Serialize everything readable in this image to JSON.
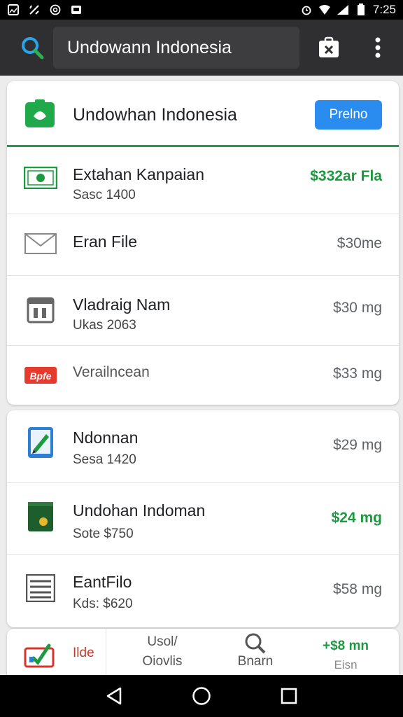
{
  "status_bar": {
    "time": "7:25"
  },
  "app_bar": {
    "search_text": "Undowann Indonesia"
  },
  "card1": {
    "header": {
      "title": "Undowhan Indonesia",
      "button_label": "Prelno"
    },
    "rows": [
      {
        "name": "Extahan Kanpaian",
        "sub": "Sasc 1400",
        "price": "$332ar Fla",
        "icon": "money-icon",
        "price_green": true
      },
      {
        "name": "Eran File",
        "sub": "",
        "price": "$30me",
        "icon": "mail-icon",
        "price_green": false
      },
      {
        "name": "Vladraig Nam",
        "sub": "Ukas 2063",
        "price": "$30 mg",
        "icon": "calendar-icon",
        "price_green": false
      },
      {
        "name": "Verailncean",
        "sub": "",
        "price": "$33 mg",
        "icon": "tag-icon",
        "price_green": false,
        "tag_text": "Bpfe"
      }
    ]
  },
  "card2": {
    "rows": [
      {
        "name": "Ndonnan",
        "sub": "Sesa 1420",
        "price": "$29 mg",
        "icon": "tablet-pen-icon",
        "price_green": false
      },
      {
        "name": "Undohan Indoman",
        "sub": "Sote $750",
        "price": "$24 mg",
        "icon": "book-icon",
        "price_green": true
      },
      {
        "name": "EantFilo",
        "sub": "Kds: $620",
        "price": "$58 mg",
        "icon": "document-list-icon",
        "price_green": false
      }
    ]
  },
  "bottom_tabs": {
    "tab1_label": "Ilde",
    "tab2_top": "Usol/",
    "tab2_bottom": "Oiovlis",
    "tab3_label": "Bnarn",
    "tab4_top": "+$8 mn",
    "tab4_bottom": "Eisn"
  },
  "colors": {
    "accent_green": "#1c9a3f",
    "button_blue": "#2b8cf0",
    "appbar": "#2f2f31"
  }
}
